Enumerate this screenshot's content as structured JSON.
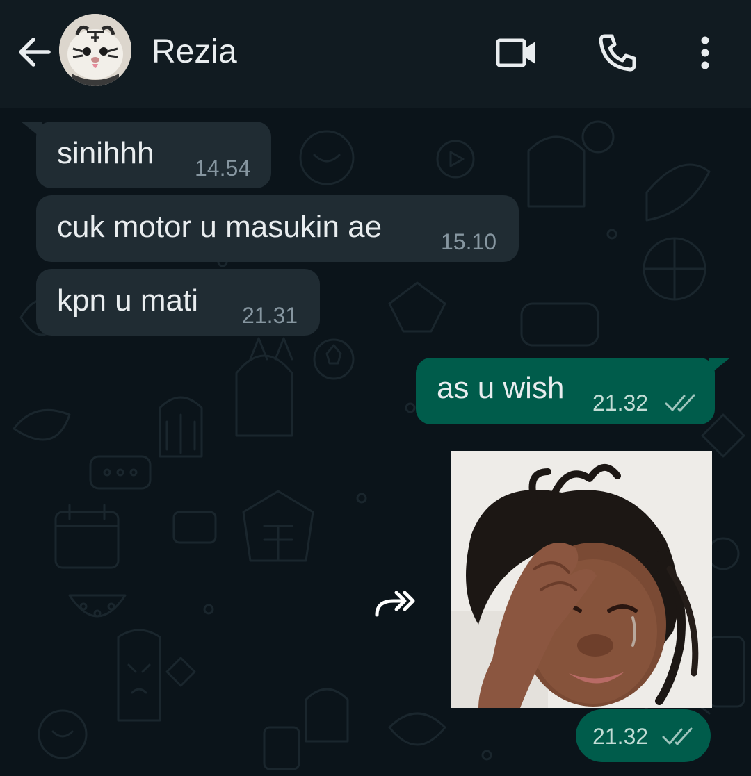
{
  "header": {
    "contact_name": "Rezia",
    "icons": {
      "back": "arrow-back-icon",
      "video": "video-call-icon",
      "voice": "voice-call-icon",
      "menu": "more-options-icon"
    }
  },
  "messages": [
    {
      "direction": "incoming",
      "text": "sinihhh",
      "time": "14.54"
    },
    {
      "direction": "incoming",
      "text": "cuk motor u masukin ae",
      "time": "15.10"
    },
    {
      "direction": "incoming",
      "text": "kpn u mati",
      "time": "21.31"
    },
    {
      "direction": "outgoing",
      "text": "as u wish",
      "time": "21.32",
      "status": "read"
    },
    {
      "direction": "outgoing",
      "type": "image",
      "time": "21.32",
      "status": "read"
    }
  ],
  "colors": {
    "header_bg": "#111b21",
    "chat_bg": "#0b141a",
    "incoming_bubble": "#202c33",
    "outgoing_bubble": "#005c4b",
    "text": "#e9edef",
    "meta_text": "#8696a0"
  }
}
